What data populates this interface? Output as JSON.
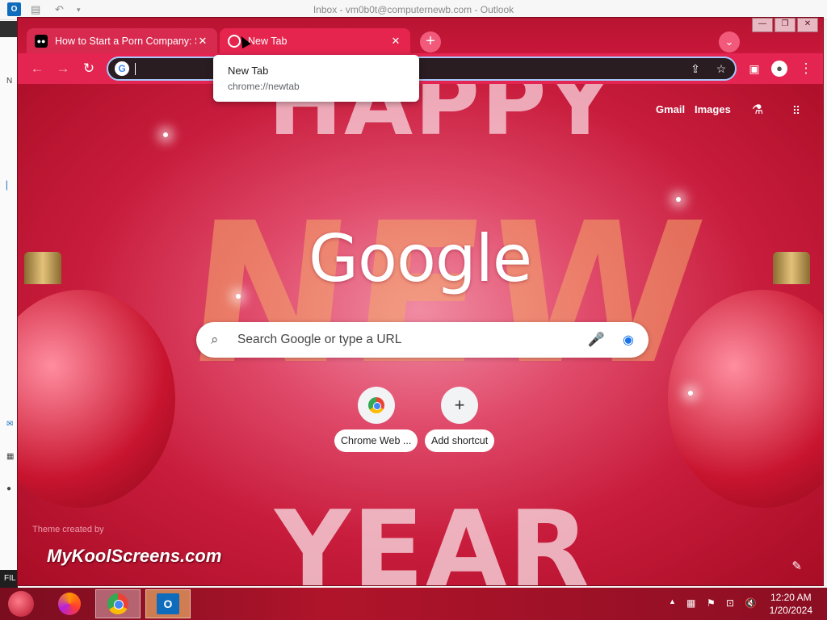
{
  "outlook": {
    "window_title": "Inbox - vm0b0t@computernewb.com - Outlook",
    "app_icon": "O",
    "file_tab": "FIL"
  },
  "chrome": {
    "tabs": [
      {
        "label": "How to Start a Porn Company: St",
        "favicon": "medium-favicon",
        "active": false
      },
      {
        "label": "New Tab",
        "favicon": "chrome-favicon",
        "active": true
      }
    ],
    "address": {
      "value": ""
    },
    "tooltip": {
      "title": "New Tab",
      "url": "chrome://newtab"
    }
  },
  "ntp": {
    "links": {
      "gmail": "Gmail",
      "images": "Images"
    },
    "logo": "Google",
    "search_placeholder": "Search Google or type a URL",
    "shortcuts": [
      {
        "label": "Chrome Web ...",
        "icon": "chrome-web-store-icon"
      },
      {
        "label": "Add shortcut",
        "icon": "plus-icon"
      }
    ],
    "theme_credit": "Theme created by",
    "theme_brand": "MyKoolScreens.com",
    "decor": {
      "happy": "HAPPY",
      "new": "NEW",
      "year": "YEAR"
    }
  },
  "taskbar": {
    "clock_time": "12:20 AM",
    "clock_date": "1/20/2024"
  },
  "colors": {
    "tabstrip": "#c8173a",
    "toolbar": "#e42451",
    "omnibox": "#2a1d22"
  }
}
